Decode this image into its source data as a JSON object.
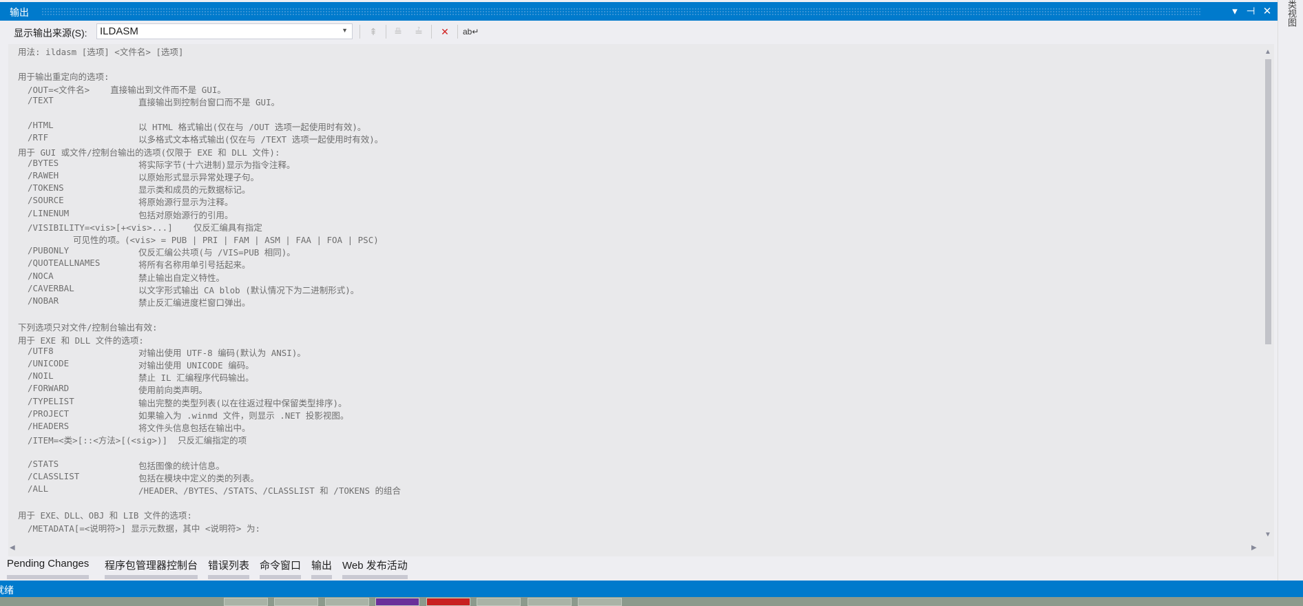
{
  "window": {
    "title": "输出"
  },
  "titlebar_buttons": [
    {
      "name": "dropdown-icon",
      "glyph": "▾"
    },
    {
      "name": "pin-icon",
      "glyph": "⊣"
    },
    {
      "name": "close-icon",
      "glyph": "✕"
    }
  ],
  "toolbar": {
    "source_label": "显示输出来源(S):",
    "source_value": "ILDASM",
    "icons": [
      "go-to-line-icon",
      "previous-message-icon",
      "next-message-icon",
      "clear-all-icon",
      "word-wrap-icon"
    ]
  },
  "output_lines": [
    {
      "k": "head",
      "t": "用法: ildasm [选项] <文件名> [选项]"
    },
    {
      "k": "blank"
    },
    {
      "k": "head",
      "t": "用于输出重定向的选项:"
    },
    {
      "k": "raw",
      "t": "/OUT=<文件名>    直接输出到文件而不是 GUI。"
    },
    {
      "k": "opt",
      "o": "/TEXT",
      "d": "直接输出到控制台窗口而不是 GUI。"
    },
    {
      "k": "blank"
    },
    {
      "k": "opt",
      "o": "/HTML",
      "d": "以 HTML 格式输出(仅在与 /OUT 选项一起使用时有效)。"
    },
    {
      "k": "opt",
      "o": "/RTF",
      "d": "以多格式文本格式输出(仅在与 /TEXT 选项一起使用时有效)。"
    },
    {
      "k": "head",
      "t": "用于 GUI 或文件/控制台输出的选项(仅限于 EXE 和 DLL 文件):"
    },
    {
      "k": "opt",
      "o": "/BYTES",
      "d": "将实际字节(十六进制)显示为指令注释。"
    },
    {
      "k": "opt",
      "o": "/RAWEH",
      "d": "以原始形式显示异常处理子句。"
    },
    {
      "k": "opt",
      "o": "/TOKENS",
      "d": "显示类和成员的元数据标记。"
    },
    {
      "k": "opt",
      "o": "/SOURCE",
      "d": "将原始源行显示为注释。"
    },
    {
      "k": "opt",
      "o": "/LINENUM",
      "d": "包括对原始源行的引用。"
    },
    {
      "k": "raw",
      "t": "/VISIBILITY=<vis>[+<vis>...]    仅反汇编具有指定"
    },
    {
      "k": "cont",
      "t": "可见性的项。(<vis> = PUB | PRI | FAM | ASM | FAA | FOA | PSC)"
    },
    {
      "k": "opt",
      "o": "/PUBONLY",
      "d": "仅反汇编公共项(与 /VIS=PUB 相同)。"
    },
    {
      "k": "opt",
      "o": "/QUOTEALLNAMES",
      "d": "将所有名称用单引号括起来。"
    },
    {
      "k": "opt",
      "o": "/NOCA",
      "d": "禁止输出自定义特性。"
    },
    {
      "k": "opt",
      "o": "/CAVERBAL",
      "d": "以文字形式输出 CA blob (默认情况下为二进制形式)。"
    },
    {
      "k": "opt",
      "o": "/NOBAR",
      "d": "禁止反汇编进度栏窗口弹出。"
    },
    {
      "k": "blank"
    },
    {
      "k": "head",
      "t": "下列选项只对文件/控制台输出有效:"
    },
    {
      "k": "head",
      "t": "用于 EXE 和 DLL 文件的选项:"
    },
    {
      "k": "opt",
      "o": "/UTF8",
      "d": "对输出使用 UTF-8 编码(默认为 ANSI)。"
    },
    {
      "k": "opt",
      "o": "/UNICODE",
      "d": "对输出使用 UNICODE 编码。"
    },
    {
      "k": "opt",
      "o": "/NOIL",
      "d": "禁止 IL 汇编程序代码输出。"
    },
    {
      "k": "opt",
      "o": "/FORWARD",
      "d": "使用前向类声明。"
    },
    {
      "k": "opt",
      "o": "/TYPELIST",
      "d": "输出完整的类型列表(以在往返过程中保留类型排序)。"
    },
    {
      "k": "opt",
      "o": "/PROJECT",
      "d": "如果输入为 .winmd 文件，则显示 .NET 投影视图。"
    },
    {
      "k": "opt",
      "o": "/HEADERS",
      "d": "将文件头信息包括在输出中。"
    },
    {
      "k": "raw",
      "t": "/ITEM=<类>[::<方法>[(<sig>)]  只反汇编指定的项"
    },
    {
      "k": "blank"
    },
    {
      "k": "opt",
      "o": "/STATS",
      "d": "包括图像的统计信息。"
    },
    {
      "k": "opt",
      "o": "/CLASSLIST",
      "d": "包括在模块中定义的类的列表。"
    },
    {
      "k": "opt",
      "o": "/ALL",
      "d": "/HEADER、/BYTES、/STATS、/CLASSLIST 和 /TOKENS 的组合"
    },
    {
      "k": "blank"
    },
    {
      "k": "head",
      "t": "用于 EXE、DLL、OBJ 和 LIB 文件的选项:"
    },
    {
      "k": "raw",
      "t": "/METADATA[=<说明符>] 显示元数据，其中 <说明符> 为:"
    }
  ],
  "right_panel": {
    "label": "类视图"
  },
  "bottom_tabs": [
    "Pending Changes",
    "程序包管理器控制台",
    "错误列表",
    "命令窗口",
    "输出",
    "Web 发布活动"
  ],
  "status": {
    "text": "就绪"
  },
  "colors": {
    "accent": "#007acc",
    "content_bg": "#e9e9eb",
    "text": "#6e6e6e"
  }
}
